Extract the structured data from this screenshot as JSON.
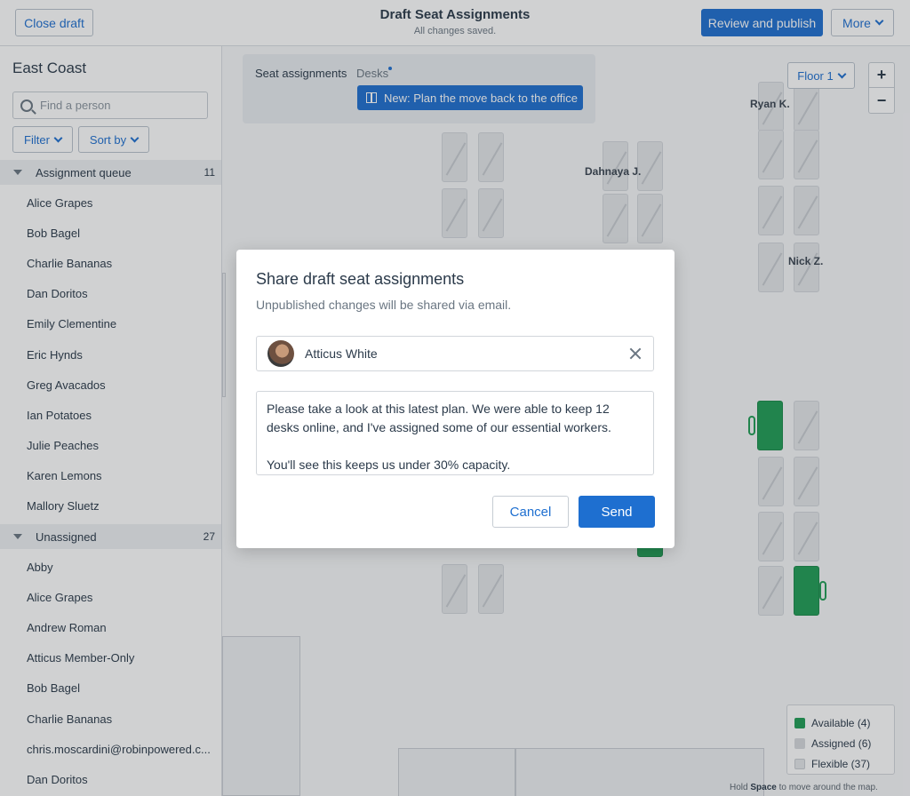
{
  "header": {
    "close_label": "Close draft",
    "title": "Draft Seat Assignments",
    "status": "All changes saved.",
    "review_label": "Review and publish",
    "more_label": "More"
  },
  "sidebar": {
    "title": "East Coast",
    "search_placeholder": "Find a person",
    "filter_label": "Filter",
    "sort_label": "Sort by",
    "groups": [
      {
        "name": "Assignment queue",
        "count": "11",
        "people": [
          "Alice Grapes",
          "Bob Bagel",
          "Charlie Bananas",
          "Dan Doritos",
          "Emily Clementine",
          "Eric Hynds",
          "Greg Avacados",
          "Ian Potatoes",
          "Julie Peaches",
          "Karen Lemons",
          "Mallory Sluetz"
        ]
      },
      {
        "name": "Unassigned",
        "count": "27",
        "people": [
          "Abby",
          "Alice Grapes",
          "Andrew Roman",
          "Atticus Member-Only",
          "Bob Bagel",
          "Charlie Bananas",
          "chris.moscardini@robinpowered.c...",
          "Dan Doritos"
        ]
      }
    ]
  },
  "map": {
    "tabs": {
      "seat": "Seat assignments",
      "desks": "Desks"
    },
    "promo": "New: Plan the move back to the office",
    "floor_label": "Floor 1",
    "zoom_in": "+",
    "zoom_out": "−",
    "labels": {
      "ryan": "Ryan K.",
      "dahnaya": "Dahnaya J.",
      "nick": "Nick Z."
    },
    "legend": [
      {
        "label": "Available (4)",
        "color": "#1f9d55"
      },
      {
        "label": "Assigned (6)",
        "color": "#d6d9dd"
      },
      {
        "label": "Flexible (37)",
        "color": "#e4e7ea"
      }
    ],
    "hint_prefix": "Hold ",
    "hint_key": "Space",
    "hint_suffix": " to move around the map."
  },
  "modal": {
    "title": "Share draft seat assignments",
    "subtitle": "Unpublished changes will be shared via email.",
    "recipient": "Atticus White",
    "message": "Please take a look at this latest plan. We were able to keep 12 desks online, and I've assigned some of our essential workers.\n\nYou'll see this keeps us under 30% capacity.",
    "cancel_label": "Cancel",
    "send_label": "Send"
  }
}
